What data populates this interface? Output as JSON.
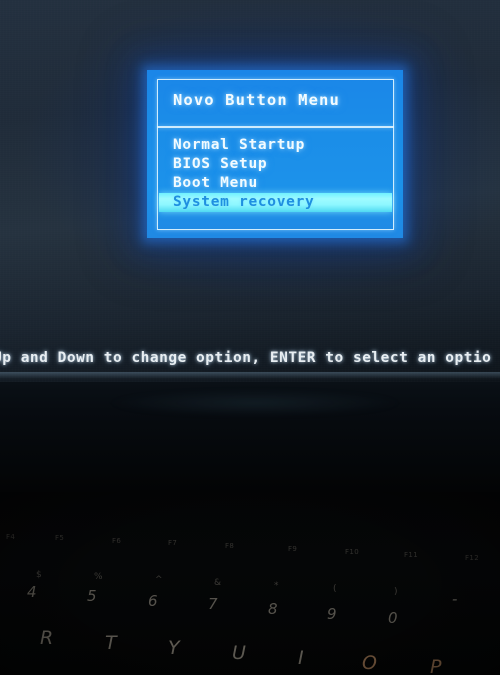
{
  "screen": {
    "novo_menu": {
      "title": "Novo Button Menu",
      "items": [
        {
          "label": "Normal Startup",
          "selected": false
        },
        {
          "label": "BIOS Setup",
          "selected": false
        },
        {
          "label": "Boot Menu",
          "selected": false
        },
        {
          "label": "System recovery",
          "selected": true
        }
      ],
      "selected_index": 3,
      "panel_bg_color": "#1b8de8",
      "text_color": "#f2fbff",
      "highlight_color": "#8df7ff",
      "highlight_text_color": "#1f8fe0",
      "border_color": "#e1f5ff"
    },
    "status_line": "Up and Down to change option, ENTER to select an optio",
    "status_line_clipped": true,
    "background_color": "#23303f"
  },
  "bezel": {
    "color": "#070b10"
  },
  "keyboard": {
    "function_row": [
      "F4",
      "F5",
      "F6",
      "F7",
      "F8",
      "F9",
      "F10",
      "F11",
      "F12"
    ],
    "number_row": [
      {
        "main": "4",
        "shift": "$"
      },
      {
        "main": "5",
        "shift": "%"
      },
      {
        "main": "6",
        "shift": "^"
      },
      {
        "main": "7",
        "shift": "&"
      },
      {
        "main": "8",
        "shift": "*"
      },
      {
        "main": "9",
        "shift": "("
      },
      {
        "main": "0",
        "shift": ")"
      },
      {
        "main": "-",
        "shift": "_"
      }
    ],
    "letter_row": [
      "R",
      "T",
      "Y",
      "U",
      "I",
      "O",
      "P"
    ],
    "key_label_color": "#cfc6b4",
    "background_color": "#040506"
  }
}
